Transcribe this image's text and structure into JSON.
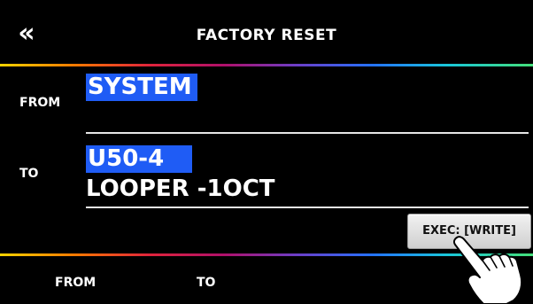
{
  "header": {
    "back_glyph": "«",
    "title": "FACTORY RESET"
  },
  "from_row": {
    "label": "FROM",
    "value": "SYSTEM"
  },
  "to_row": {
    "label": "TO",
    "patch_number": "U50-4",
    "patch_name": "LOOPER -1OCT"
  },
  "exec_button": {
    "label": "EXEC: [WRITE]"
  },
  "footer": {
    "from_label": "FROM",
    "to_label": "TO"
  },
  "colors": {
    "selection_highlight": "#1f5cf5",
    "background": "#000000",
    "text": "#ffffff"
  },
  "icons": {
    "back": "double-chevron-left-icon",
    "hand": "pointing-hand-icon"
  }
}
